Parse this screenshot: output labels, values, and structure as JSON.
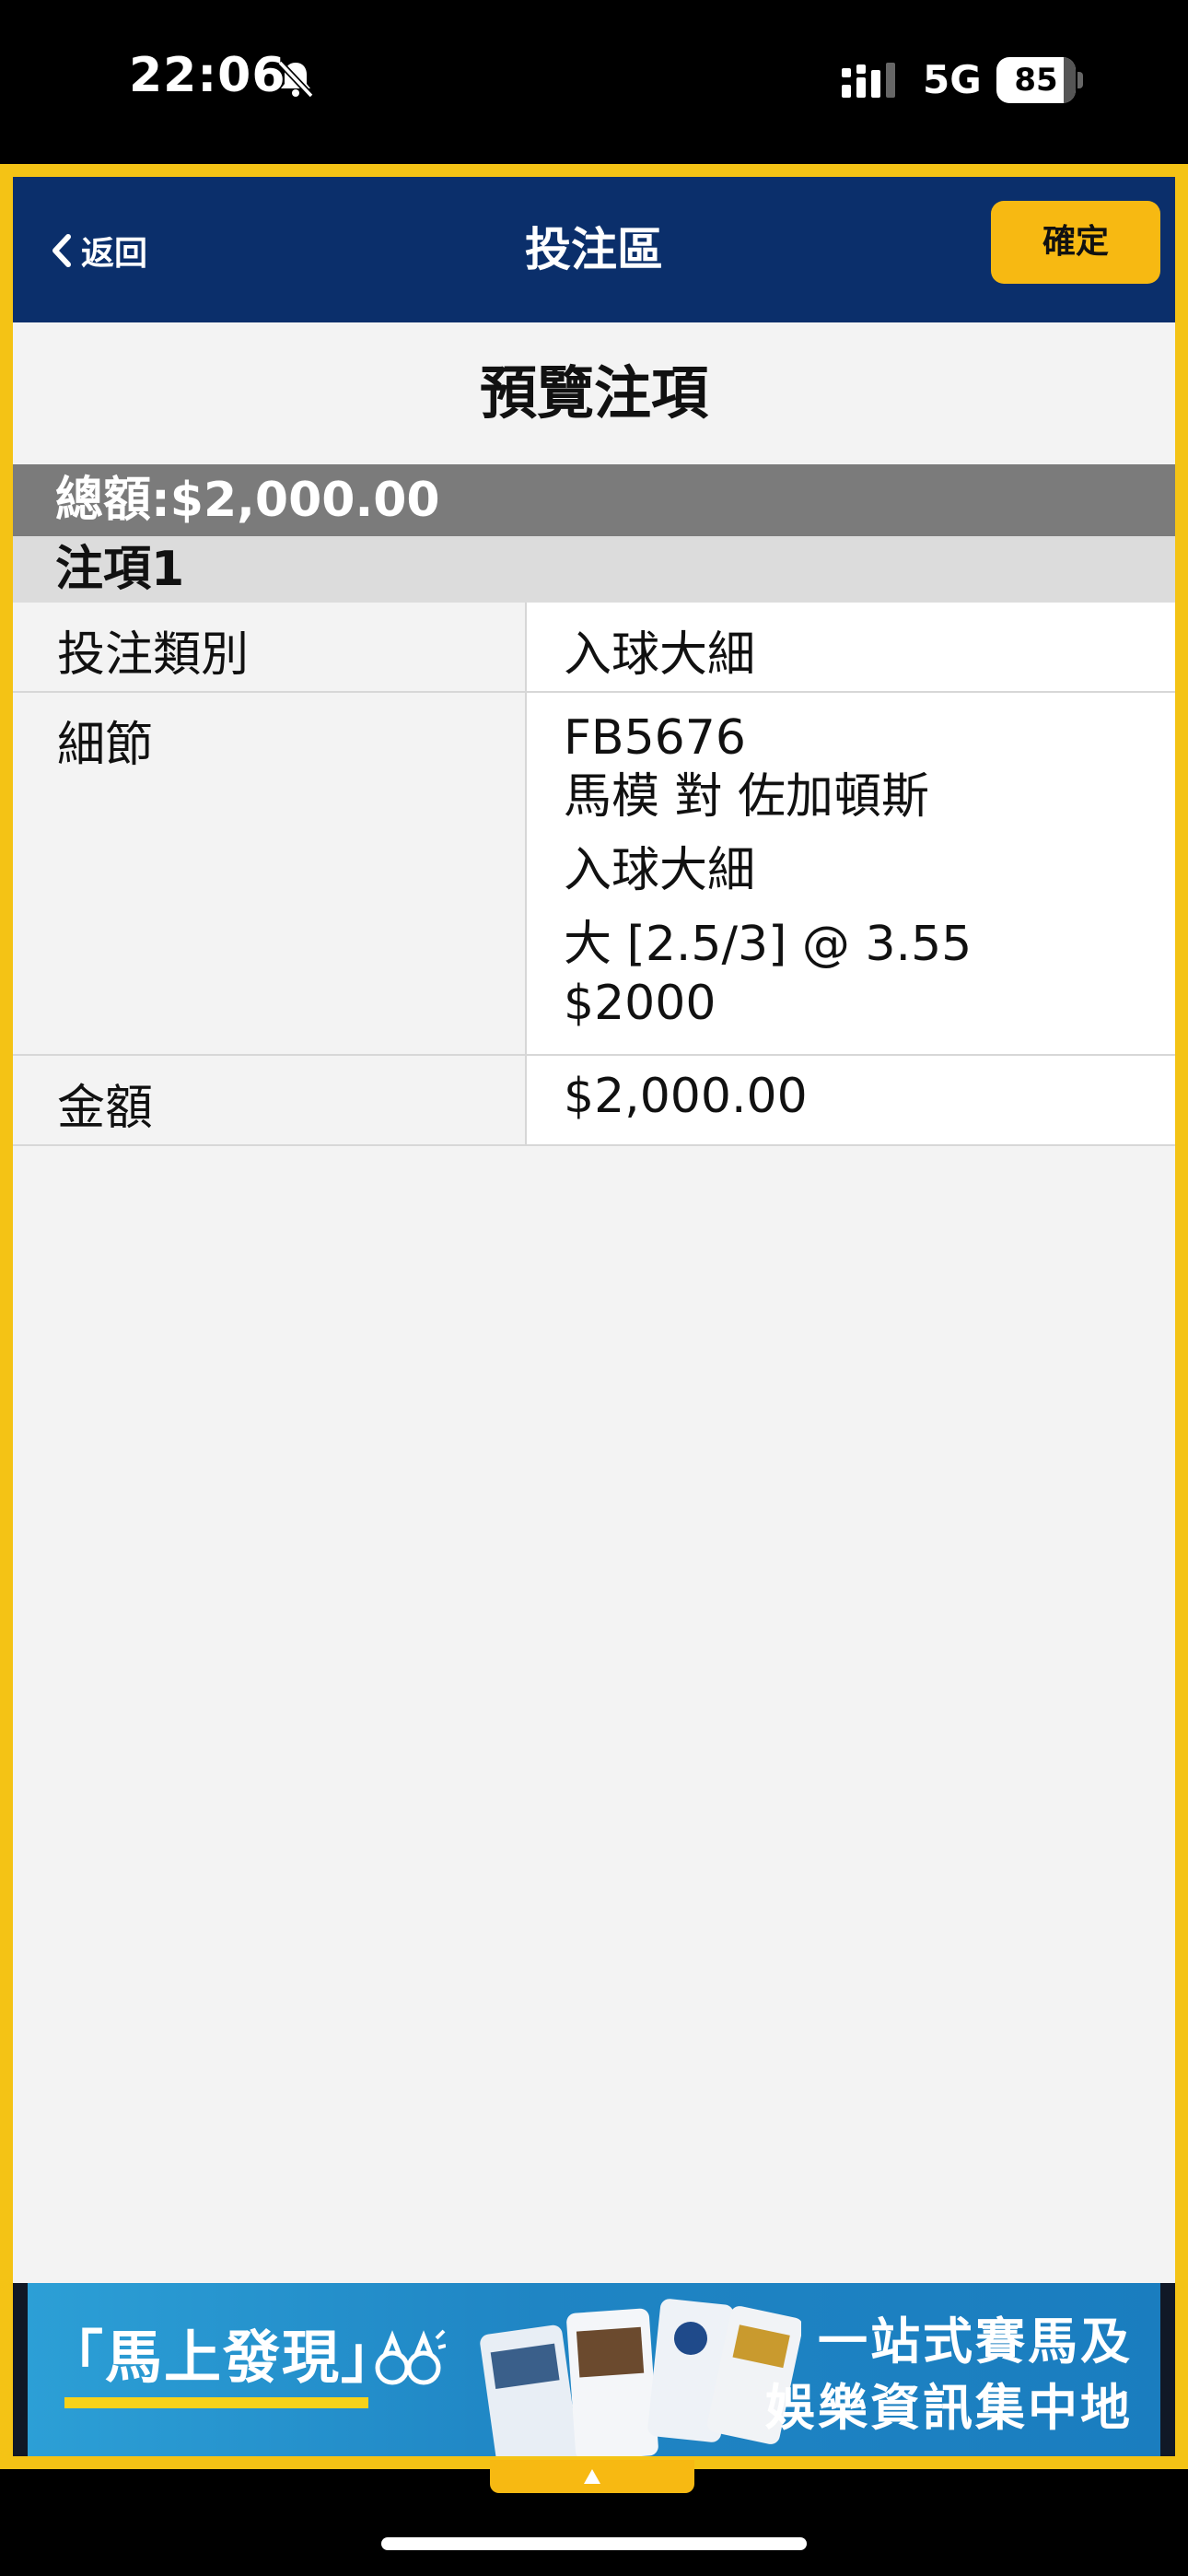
{
  "status_bar": {
    "time": "22:06",
    "network": "5G",
    "battery": "85"
  },
  "nav": {
    "back_label": "返回",
    "title": "投注區",
    "confirm_label": "確定"
  },
  "page": {
    "header": "預覽注項",
    "total": "總額:$2,000.00",
    "item_header": "注項1"
  },
  "bet": {
    "type_label": "投注類別",
    "type_value": "入球大細",
    "detail_label": "細節",
    "detail_lines": [
      "FB5676",
      "馬模 對 佐加頓斯",
      "入球大細",
      "大 [2.5/3] @ 3.55",
      "$2000"
    ],
    "amount_label": "金額",
    "amount_value": "$2,000.00"
  },
  "ad": {
    "headline": "「馬上發現」",
    "tagline_line1": "一站式賽馬及",
    "tagline_line2": "娛樂資訊集中地"
  },
  "colors": {
    "nav_bg": "#0b2f6b",
    "frame": "#f4c315",
    "button": "#f7b912",
    "total_bar": "#7b7b7b",
    "item_header": "#dcdcdc"
  }
}
